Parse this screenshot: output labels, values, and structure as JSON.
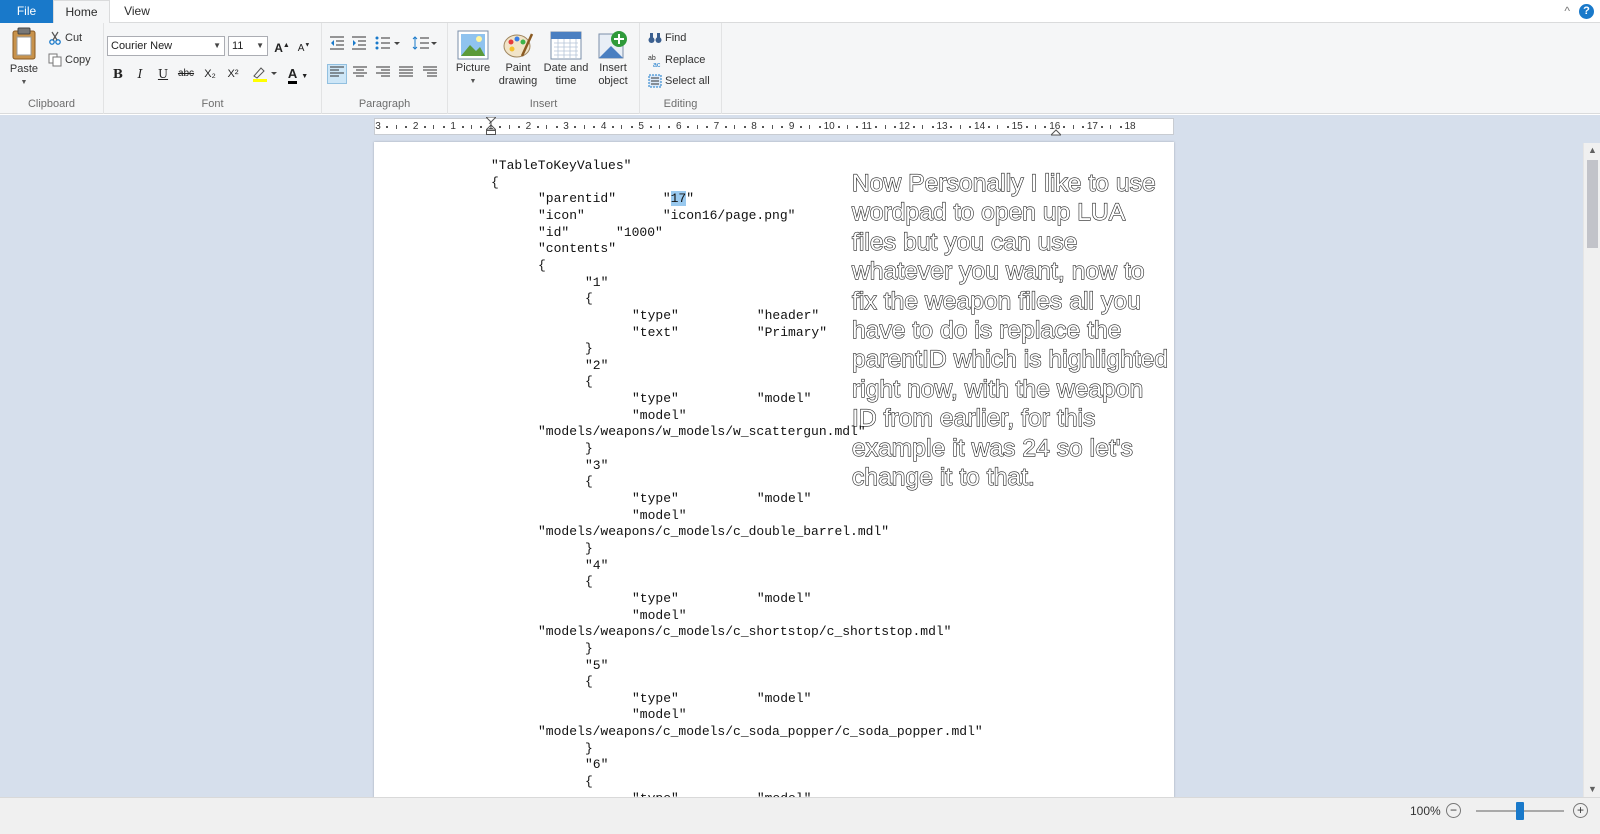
{
  "tabs": {
    "file": "File",
    "home": "Home",
    "view": "View"
  },
  "title_controls": {
    "minimize_ribbon": "^",
    "help": "?"
  },
  "ribbon": {
    "clipboard": {
      "label": "Clipboard",
      "paste": "Paste",
      "cut": "Cut",
      "copy": "Copy"
    },
    "font": {
      "label": "Font",
      "family": "Courier New",
      "size": "11",
      "bold": "B",
      "italic": "I",
      "underline": "U",
      "strike": "abc",
      "subscript": "X₂",
      "superscript": "X²",
      "color_letter": "A"
    },
    "paragraph": {
      "label": "Paragraph"
    },
    "insert": {
      "label": "Insert",
      "picture": "Picture",
      "paint_drawing_1": "Paint",
      "paint_drawing_2": "drawing",
      "date_time_1": "Date and",
      "date_time_2": "time",
      "insert_object_1": "Insert",
      "insert_object_2": "object"
    },
    "editing": {
      "label": "Editing",
      "find": "Find",
      "replace": "Replace",
      "select_all": "Select all"
    }
  },
  "ruler": {
    "numbers": [
      "3",
      "2",
      "1",
      "1",
      "2",
      "3",
      "4",
      "5",
      "6",
      "7",
      "8",
      "9",
      "10",
      "11",
      "12",
      "13",
      "14",
      "15",
      "16",
      "17",
      "18"
    ]
  },
  "document": {
    "lines": [
      {
        "text": "\"TableToKeyValues\""
      },
      {
        "text": "{"
      },
      {
        "pre": "\"parentid\"      \"",
        "highlight": "17",
        "post": "\""
      },
      {
        "text": "\"icon\"          \"icon16/page.png\""
      },
      {
        "text": "\"id\"      \"1000\""
      },
      {
        "text": "\"contents\""
      },
      {
        "text": "{"
      },
      {
        "text": "\"1\""
      },
      {
        "text": "{"
      },
      {
        "text": "\"type\"          \"header\""
      },
      {
        "text": "\"text\"          \"Primary\""
      },
      {
        "text": "}"
      },
      {
        "text": "\"2\""
      },
      {
        "text": "{"
      },
      {
        "text": "\"type\"          \"model\""
      },
      {
        "text": "\"model\""
      },
      {
        "text": "\"models/weapons/w_models/w_scattergun.mdl\""
      },
      {
        "text": "}"
      },
      {
        "text": "\"3\""
      },
      {
        "text": "{"
      },
      {
        "text": "\"type\"          \"model\""
      },
      {
        "text": "\"model\""
      },
      {
        "text": "\"models/weapons/c_models/c_double_barrel.mdl\""
      },
      {
        "text": "}"
      },
      {
        "text": "\"4\""
      },
      {
        "text": "{"
      },
      {
        "text": "\"type\"          \"model\""
      },
      {
        "text": "\"model\""
      },
      {
        "text": "\"models/weapons/c_models/c_shortstop/c_shortstop.mdl\""
      },
      {
        "text": "}"
      },
      {
        "text": "\"5\""
      },
      {
        "text": "{"
      },
      {
        "text": "\"type\"          \"model\""
      },
      {
        "text": "\"model\""
      },
      {
        "text": "\"models/weapons/c_models/c_soda_popper/c_soda_popper.mdl\""
      },
      {
        "text": "}"
      },
      {
        "text": "\"6\""
      },
      {
        "text": "{"
      },
      {
        "text": "\"type\"          \"model\""
      }
    ],
    "overlay_text": "Now Personally I like to use wordpad to open up LUA files but you can use whatever you want, now to fix the weapon files all you have to do is replace the parentID which is highlighted right now, with the weapon ID from earlier, for this example it was 24 so let's change it to that."
  },
  "status": {
    "zoom_text": "100%",
    "zoom_level": 1.0,
    "zoom_out": "−",
    "zoom_in": "+"
  },
  "colors": {
    "accent": "#1979ca",
    "selection": "#99c9ef",
    "workspace": "#d6dfec"
  }
}
